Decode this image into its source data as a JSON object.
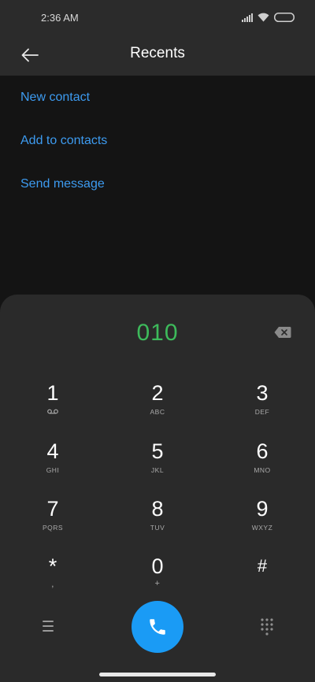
{
  "status_bar": {
    "time": "2:36 AM",
    "icons": [
      "signal-icon",
      "wifi-icon",
      "battery-icon"
    ]
  },
  "header": {
    "title": "Recents",
    "back_icon": "arrow-left-icon"
  },
  "actions": [
    {
      "label": "New contact"
    },
    {
      "label": "Add to contacts"
    },
    {
      "label": "Send message"
    }
  ],
  "dialer": {
    "number": "010",
    "backspace_icon": "backspace-icon",
    "keys": [
      {
        "digit": "1",
        "letters": ""
      },
      {
        "digit": "2",
        "letters": "ABC"
      },
      {
        "digit": "3",
        "letters": "DEF"
      },
      {
        "digit": "4",
        "letters": "GHI"
      },
      {
        "digit": "5",
        "letters": "JKL"
      },
      {
        "digit": "6",
        "letters": "MNO"
      },
      {
        "digit": "7",
        "letters": "PQRS"
      },
      {
        "digit": "8",
        "letters": "TUV"
      },
      {
        "digit": "9",
        "letters": "WXYZ"
      },
      {
        "digit": "*",
        "letters": ","
      },
      {
        "digit": "0",
        "letters": "+"
      },
      {
        "digit": "#",
        "letters": ""
      }
    ],
    "menu_icon": "menu-icon",
    "call_icon": "phone-icon",
    "keypad_icon": "dialpad-icon"
  },
  "colors": {
    "accent_link": "#3d9bf0",
    "dialed_number": "#3dba5b",
    "call_button": "#1a9bf5",
    "panel_bg": "#2a2a2a",
    "app_bg": "#141414"
  }
}
